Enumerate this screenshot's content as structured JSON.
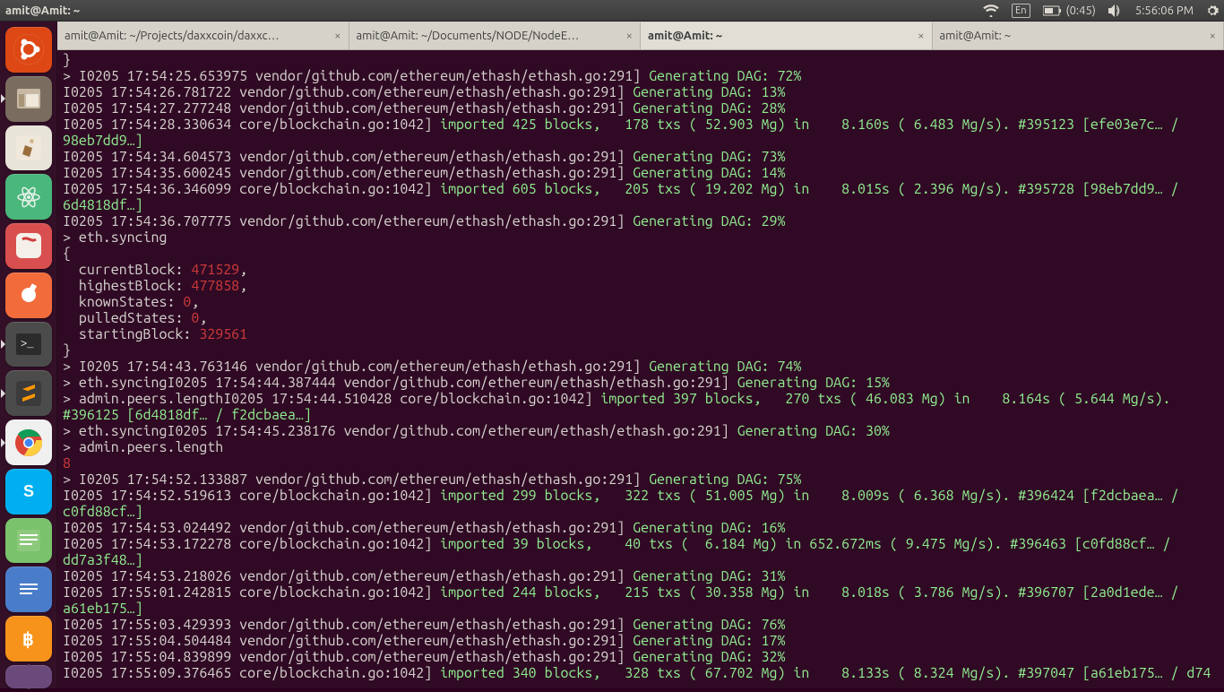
{
  "topbar": {
    "title": "amit@Amit: ~",
    "lang": "En",
    "battery": "(0:45)",
    "time": "5:56:06 PM"
  },
  "tabs": [
    {
      "label": "amit@Amit: ~/Projects/daxxcoin/daxxc…",
      "active": false
    },
    {
      "label": "amit@Amit: ~/Documents/NODE/NodeE…",
      "active": false
    },
    {
      "label": "amit@Amit: ~",
      "active": true
    },
    {
      "label": "amit@Amit: ~",
      "active": false
    }
  ],
  "launcher_items": [
    {
      "name": "dash",
      "bg": "#dd4814",
      "glyph": "ubuntu",
      "running": false
    },
    {
      "name": "files",
      "bg": "#7a6d5f",
      "glyph": "files",
      "running": true
    },
    {
      "name": "gedit",
      "bg": "#e8e4da",
      "glyph": "pencil",
      "running": false
    },
    {
      "name": "atom",
      "bg": "#4ab77c",
      "glyph": "atom",
      "running": false
    },
    {
      "name": "reader",
      "bg": "#d94f4f",
      "glyph": "book",
      "running": false
    },
    {
      "name": "postman",
      "bg": "#f26b3a",
      "glyph": "circle",
      "running": false
    },
    {
      "name": "terminal",
      "bg": "#4b4b4b",
      "glyph": "term",
      "running": true
    },
    {
      "name": "sublime",
      "bg": "#4b4b4b",
      "glyph": "subl",
      "running": true
    },
    {
      "name": "chrome",
      "bg": "#f0f0f0",
      "glyph": "chrome",
      "running": true
    },
    {
      "name": "skype",
      "bg": "#00aff0",
      "glyph": "s",
      "running": false
    },
    {
      "name": "notes",
      "bg": "#7ac26c",
      "glyph": "notes",
      "running": false
    },
    {
      "name": "docs",
      "bg": "#4a7dc9",
      "glyph": "docs",
      "running": false
    },
    {
      "name": "bitcoin",
      "bg": "#f7931a",
      "glyph": "btc",
      "running": false
    },
    {
      "name": "dev1",
      "bg": "#6a4a7a",
      "glyph": "hex",
      "running": false
    }
  ],
  "terminal": {
    "line00": "}",
    "line01a": "> I0205 17:54:25.653975 vendor/github.com/ethereum/ethash/ethash.go:291] ",
    "line01b": "Generating DAG: 72%",
    "line02a": "I0205 17:54:26.781722 vendor/github.com/ethereum/ethash/ethash.go:291] ",
    "line02b": "Generating DAG: 13%",
    "line03a": "I0205 17:54:27.277248 vendor/github.com/ethereum/ethash/ethash.go:291] ",
    "line03b": "Generating DAG: 28%",
    "line04a": "I0205 17:54:28.330634 core/blockchain.go:1042] ",
    "line04b": "imported 425 blocks,   178 txs ( 52.903 Mg) in    8.160s ( 6.483 Mg/s). #395123 [efe03e7c… / 98eb7dd9…]",
    "line05a": "I0205 17:54:34.604573 vendor/github.com/ethereum/ethash/ethash.go:291] ",
    "line05b": "Generating DAG: 73%",
    "line06a": "I0205 17:54:35.600245 vendor/github.com/ethereum/ethash/ethash.go:291] ",
    "line06b": "Generating DAG: 14%",
    "line07a": "I0205 17:54:36.346099 core/blockchain.go:1042] ",
    "line07b": "imported 605 blocks,   205 txs ( 19.202 Mg) in    8.015s ( 2.396 Mg/s). #395728 [98eb7dd9… / 6d4818df…]",
    "line08a": "I0205 17:54:36.707775 vendor/github.com/ethereum/ethash/ethash.go:291] ",
    "line08b": "Generating DAG: 29%",
    "line09": "> eth.syncing",
    "line10": "{",
    "sync_currentBlock_k": "  currentBlock: ",
    "sync_currentBlock_v": "471529",
    "sync_highestBlock_k": "  highestBlock: ",
    "sync_highestBlock_v": "477858",
    "sync_knownStates_k": "  knownStates: ",
    "sync_knownStates_v": "0",
    "sync_pulledStates_k": "  pulledStates: ",
    "sync_pulledStates_v": "0",
    "sync_startingBlock_k": "  startingBlock: ",
    "sync_startingBlock_v": "329561",
    "line16": "}",
    "line17a": "> I0205 17:54:43.763146 vendor/github.com/ethereum/ethash/ethash.go:291] ",
    "line17b": "Generating DAG: 74%",
    "line18a": "> eth.syncingI0205 17:54:44.387444 vendor/github.com/ethereum/ethash/ethash.go:291] ",
    "line18b": "Generating DAG: 15%",
    "line19a": "> admin.peers.lengthI0205 17:54:44.510428 core/blockchain.go:1042] ",
    "line19b": "imported 397 blocks,   270 txs ( 46.083 Mg) in    8.164s ( 5.644 Mg/s). #396125 [6d4818df… / f2dcbaea…]",
    "line20a": "> eth.syncingI0205 17:54:45.238176 vendor/github.com/ethereum/ethash/ethash.go:291] ",
    "line20b": "Generating DAG: 30%",
    "line21": "> admin.peers.length",
    "line22": "8",
    "line23a": "> I0205 17:54:52.133887 vendor/github.com/ethereum/ethash/ethash.go:291] ",
    "line23b": "Generating DAG: 75%",
    "line24a": "I0205 17:54:52.519613 core/blockchain.go:1042] ",
    "line24b": "imported 299 blocks,   322 txs ( 51.005 Mg) in    8.009s ( 6.368 Mg/s). #396424 [f2dcbaea… / c0fd88cf…]",
    "line25a": "I0205 17:54:53.024492 vendor/github.com/ethereum/ethash/ethash.go:291] ",
    "line25b": "Generating DAG: 16%",
    "line26a": "I0205 17:54:53.172278 core/blockchain.go:1042] ",
    "line26b": "imported 39 blocks,    40 txs (  6.184 Mg) in 652.672ms ( 9.475 Mg/s). #396463 [c0fd88cf… / dd7a3f48…]",
    "line27a": "I0205 17:54:53.218026 vendor/github.com/ethereum/ethash/ethash.go:291] ",
    "line27b": "Generating DAG: 31%",
    "line28a": "I0205 17:55:01.242815 core/blockchain.go:1042] ",
    "line28b": "imported 244 blocks,   215 txs ( 30.358 Mg) in    8.018s ( 3.786 Mg/s). #396707 [2a0d1ede… / a61eb175…]",
    "line29a": "I0205 17:55:03.429393 vendor/github.com/ethereum/ethash/ethash.go:291] ",
    "line29b": "Generating DAG: 76%",
    "line30a": "I0205 17:55:04.504484 vendor/github.com/ethereum/ethash/ethash.go:291] ",
    "line30b": "Generating DAG: 17%",
    "line31a": "I0205 17:55:04.839899 vendor/github.com/ethereum/ethash/ethash.go:291] ",
    "line31b": "Generating DAG: 32%",
    "line32a": "I0205 17:55:09.376465 core/blockchain.go:1042] ",
    "line32b": "imported 340 blocks,   328 txs ( 67.702 Mg) in    8.133s ( 8.324 Mg/s). #397047 [a61eb175… / d74"
  }
}
